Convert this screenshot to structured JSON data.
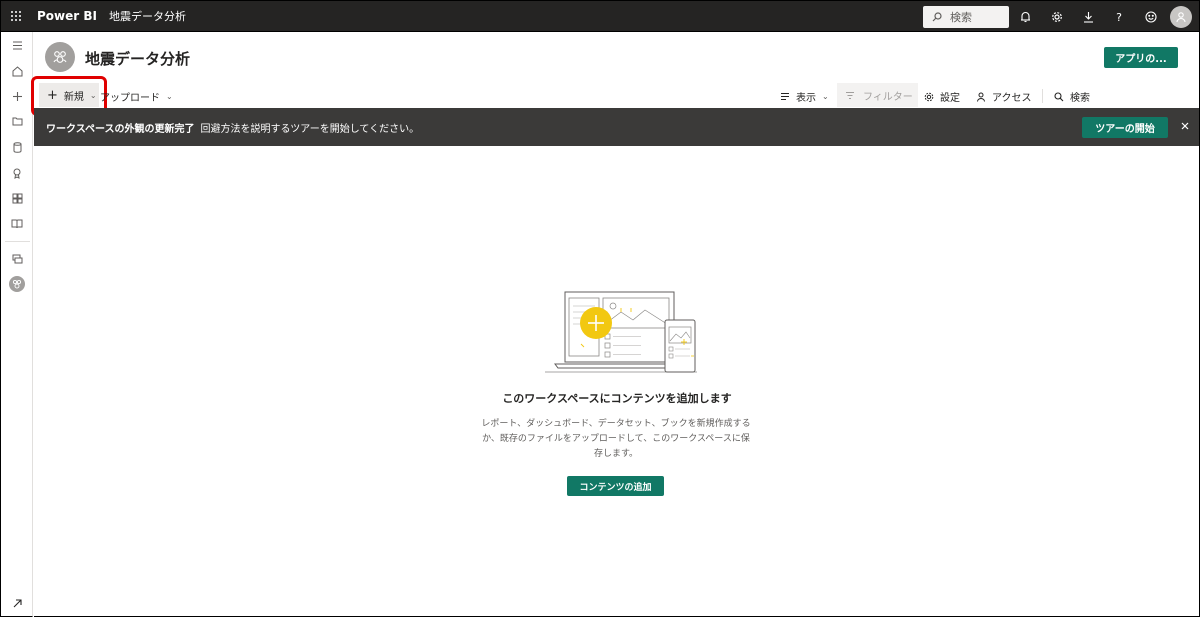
{
  "topbar": {
    "brand": "Power BI",
    "workspace": "地震データ分析",
    "search_placeholder": "検索",
    "help_label": "?",
    "icons": [
      "waffle-icon",
      "bell-icon",
      "gear-icon",
      "download-icon",
      "help-icon",
      "smiley-icon",
      "account-avatar"
    ]
  },
  "leftnav": {
    "items": [
      "hamburger-icon",
      "home-icon",
      "create-icon",
      "browse-icon",
      "data-hub-icon",
      "metrics-icon",
      "apps-icon",
      "learn-icon",
      "workspaces-icon",
      "current-workspace-icon",
      "expand-icon"
    ]
  },
  "header": {
    "title": "地震データ分析",
    "app_button": "アプリの..."
  },
  "commandbar": {
    "new_label": "新規",
    "upload_label": "アップロード",
    "view_label": "表示",
    "filter_label": "フィルター",
    "settings_label": "設定",
    "access_label": "アクセス",
    "search_label": "検索"
  },
  "banner": {
    "bold_text": "ワークスペースの外観の更新完了",
    "text": "回避方法を説明するツアーを開始してください。",
    "tour_button": "ツアーの開始"
  },
  "empty_state": {
    "title": "このワークスペースにコンテンツを追加します",
    "desc_line1": "レポート、ダッシュボード、データセット、ブックを新規作成する",
    "desc_line2": "か、既存のファイルをアップロードして、このワークスペースに保",
    "desc_line3": "存します。",
    "add_button": "コンテンツの追加"
  },
  "colors": {
    "topbar": "#252423",
    "accent": "#117865",
    "banner": "#3b3a39",
    "highlight": "#e00000",
    "illustration_yellow": "#f2c811"
  }
}
